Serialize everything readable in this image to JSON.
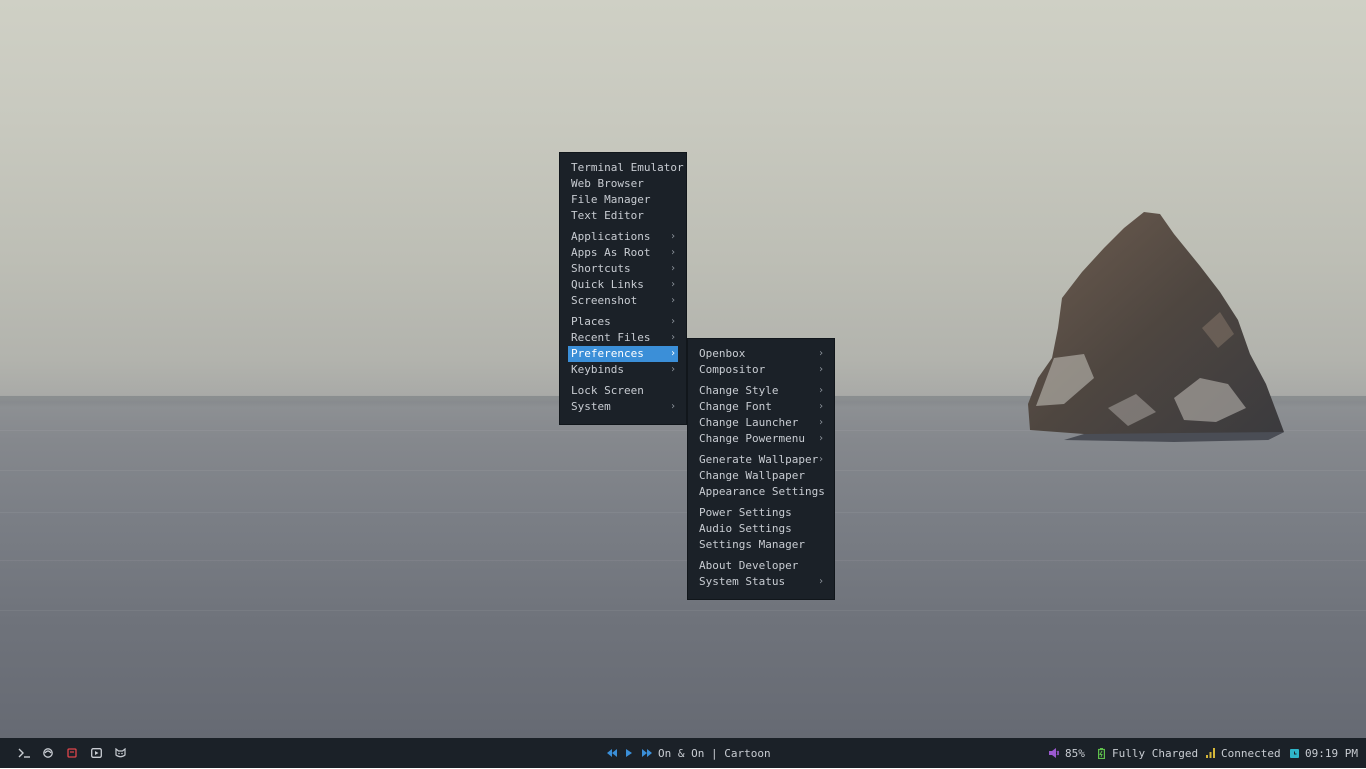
{
  "main_menu": {
    "groups": [
      [
        {
          "label": "Terminal Emulator",
          "submenu": false
        },
        {
          "label": "Web Browser",
          "submenu": false
        },
        {
          "label": "File Manager",
          "submenu": false
        },
        {
          "label": "Text Editor",
          "submenu": false
        }
      ],
      [
        {
          "label": "Applications",
          "submenu": true
        },
        {
          "label": "Apps As Root",
          "submenu": true
        },
        {
          "label": "Shortcuts",
          "submenu": true
        },
        {
          "label": "Quick Links",
          "submenu": true
        },
        {
          "label": "Screenshot",
          "submenu": true
        }
      ],
      [
        {
          "label": "Places",
          "submenu": true
        },
        {
          "label": "Recent Files",
          "submenu": true
        },
        {
          "label": "Preferences",
          "submenu": true,
          "selected": true
        },
        {
          "label": "Keybinds",
          "submenu": true
        }
      ],
      [
        {
          "label": "Lock Screen",
          "submenu": false
        },
        {
          "label": "System",
          "submenu": true
        }
      ]
    ]
  },
  "preferences_menu": {
    "groups": [
      [
        {
          "label": "Openbox",
          "submenu": true
        },
        {
          "label": "Compositor",
          "submenu": true
        }
      ],
      [
        {
          "label": "Change Style",
          "submenu": true
        },
        {
          "label": "Change Font",
          "submenu": true
        },
        {
          "label": "Change Launcher",
          "submenu": true
        },
        {
          "label": "Change Powermenu",
          "submenu": true
        }
      ],
      [
        {
          "label": "Generate Wallpaper",
          "submenu": true
        },
        {
          "label": "Change Wallpaper",
          "submenu": false
        },
        {
          "label": "Appearance Settings",
          "submenu": false
        }
      ],
      [
        {
          "label": "Power Settings",
          "submenu": false
        },
        {
          "label": "Audio Settings",
          "submenu": false
        },
        {
          "label": "Settings Manager",
          "submenu": false
        }
      ],
      [
        {
          "label": "About Developer",
          "submenu": false
        },
        {
          "label": "System Status",
          "submenu": true
        }
      ]
    ]
  },
  "submenu_arrow": "›",
  "taskbar": {
    "launchers": [
      {
        "name": "terminal-icon",
        "color": "#c8ccd2"
      },
      {
        "name": "browser-icon",
        "color": "#c8ccd2"
      },
      {
        "name": "file-manager-icon",
        "color": "#e0454b"
      },
      {
        "name": "media-player-icon",
        "color": "#c8ccd2"
      },
      {
        "name": "cat-icon",
        "color": "#c8ccd2"
      }
    ],
    "player": {
      "now_playing": "On & On | Cartoon",
      "control_color": "#3b8fd8"
    },
    "status": {
      "volume": "85%",
      "volume_color": "#9b59d0",
      "battery": "Fully Charged",
      "battery_color": "#5fbf4c",
      "network": "Connected",
      "network_color": "#d6b83a",
      "time": "09:19 PM",
      "clock_color": "#2fb5c8"
    }
  }
}
